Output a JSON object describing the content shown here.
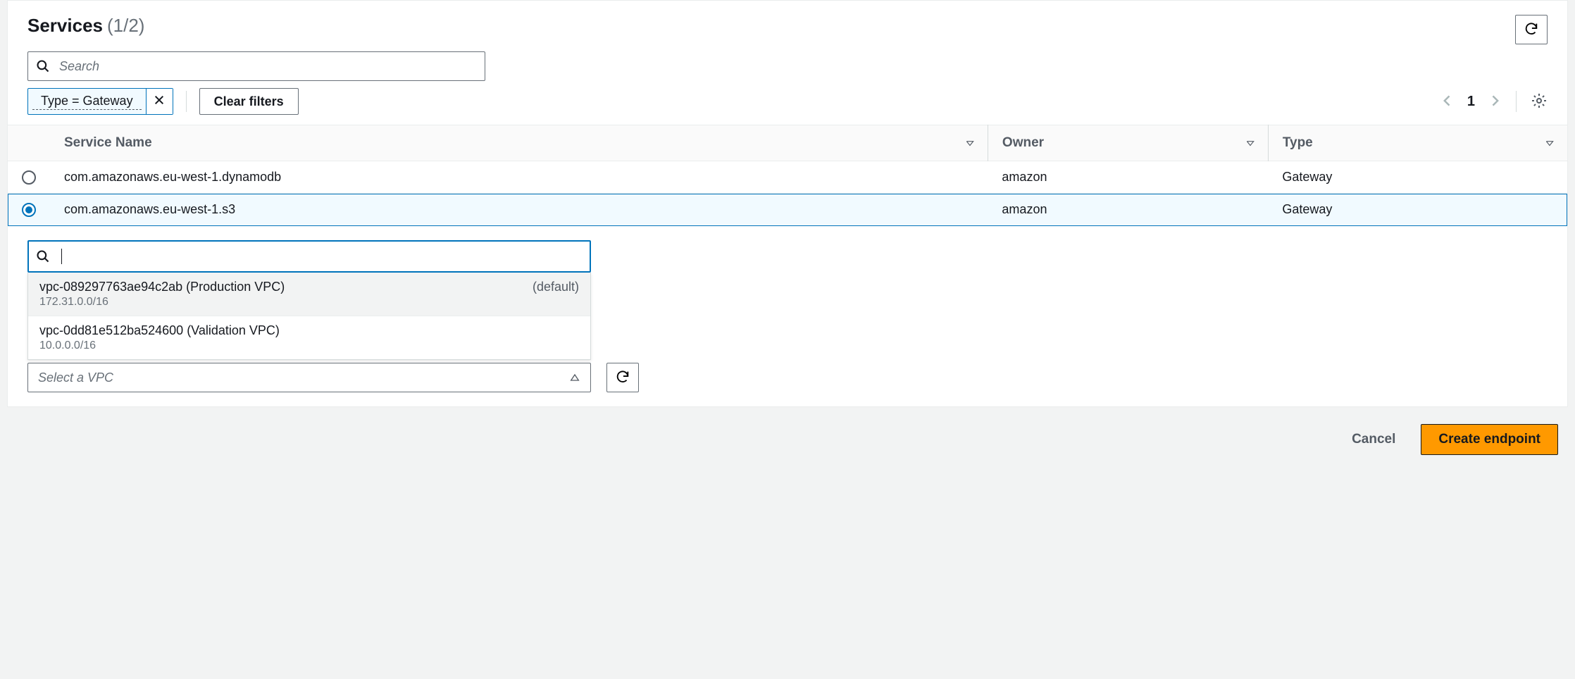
{
  "panel": {
    "title": "Services",
    "count": "(1/2)",
    "search_placeholder": "Search",
    "filter_chip": "Type = Gateway",
    "clear_filters": "Clear filters",
    "page_number": "1"
  },
  "table": {
    "headers": {
      "service_name": "Service Name",
      "owner": "Owner",
      "type": "Type"
    },
    "rows": [
      {
        "service_name": "com.amazonaws.eu-west-1.dynamodb",
        "owner": "amazon",
        "type": "Gateway",
        "selected": false
      },
      {
        "service_name": "com.amazonaws.eu-west-1.s3",
        "owner": "amazon",
        "type": "Gateway",
        "selected": true
      }
    ]
  },
  "vpc_dropdown": {
    "items": [
      {
        "label": "vpc-089297763ae94c2ab (Production VPC)",
        "default_tag": "(default)",
        "cidr": "172.31.0.0/16",
        "highlighted": true
      },
      {
        "label": "vpc-0dd81e512ba524600 (Validation VPC)",
        "default_tag": "",
        "cidr": "10.0.0.0/16",
        "highlighted": false
      }
    ],
    "select_placeholder": "Select a VPC"
  },
  "footer": {
    "cancel": "Cancel",
    "create": "Create endpoint"
  }
}
